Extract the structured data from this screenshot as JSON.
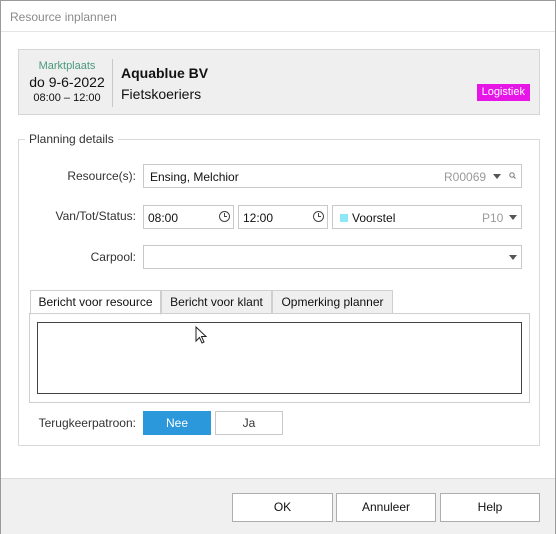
{
  "window": {
    "title": "Resource inplannen"
  },
  "header": {
    "date_label": "Marktplaats",
    "date": "do 9-6-2022",
    "time_range": "08:00  –  12:00",
    "company": "Aquablue BV",
    "subtitle": "Fietskoeriers",
    "tag": "Logistiek",
    "tag_color": "#e617e6"
  },
  "planning": {
    "legend": "Planning details",
    "resource": {
      "label": "Resource(s):",
      "value": "Ensing, Melchior",
      "code": "R00069"
    },
    "van_tot_status": {
      "label": "Van/Tot/Status:",
      "from": "08:00",
      "to": "12:00",
      "status": "Voorstel",
      "status_code": "P10",
      "status_color": "#8fe6f5"
    },
    "carpool": {
      "label": "Carpool:",
      "value": ""
    },
    "tabs": [
      {
        "label": "Bericht voor resource",
        "active": true
      },
      {
        "label": "Bericht voor klant",
        "active": false
      },
      {
        "label": "Opmerking planner",
        "active": false
      }
    ],
    "message": "",
    "terugkeer": {
      "label": "Terugkeerpatroon:",
      "no": "Nee",
      "yes": "Ja",
      "selected": "Nee"
    }
  },
  "footer": {
    "ok": "OK",
    "cancel": "Annuleer",
    "help": "Help"
  },
  "colors": {
    "accent": "#2a98da"
  }
}
